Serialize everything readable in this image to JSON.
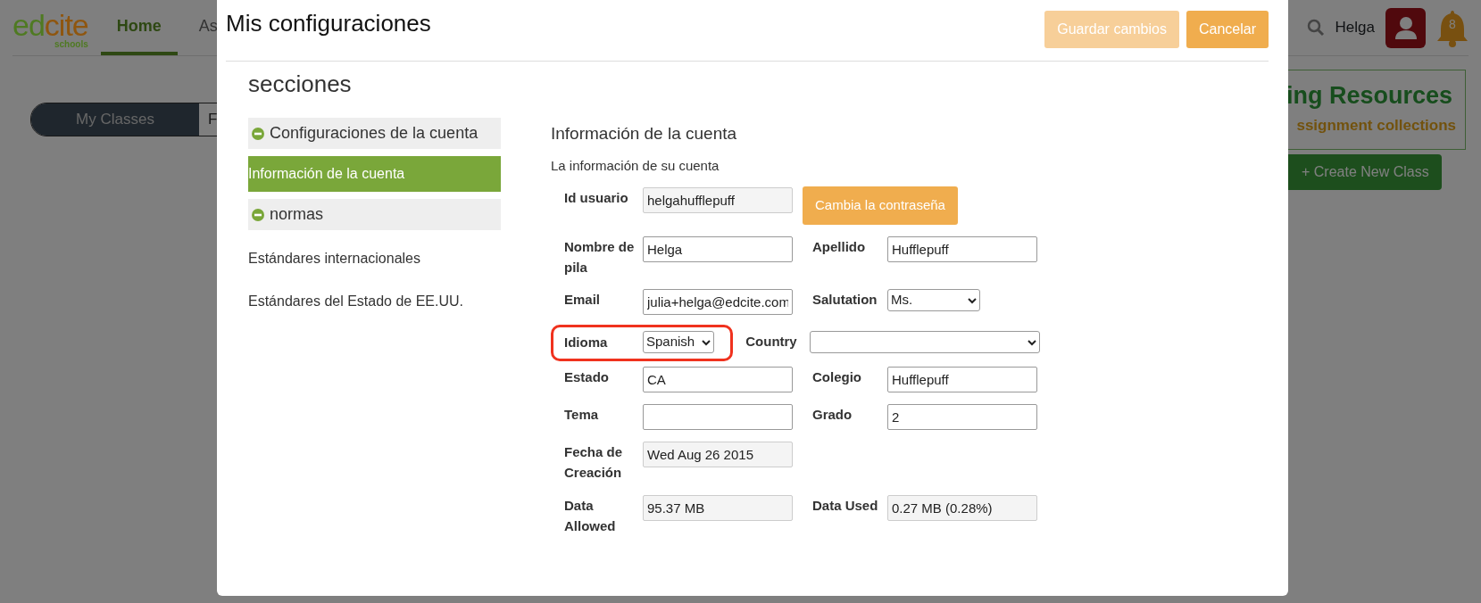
{
  "background": {
    "logo": {
      "parts": [
        {
          "text": "ed",
          "color": "#4f7a22"
        },
        {
          "text": "cite",
          "color": "#8f560f"
        }
      ],
      "tagline": "schools"
    },
    "nav": [
      {
        "label": "Home",
        "selected": true
      },
      {
        "label": "As",
        "selected": false
      }
    ],
    "class_tabs": [
      {
        "label": "My Classes",
        "selected": true
      },
      {
        "label": "F",
        "selected": false
      }
    ],
    "user": "Helga",
    "notifications": "8",
    "resources_title": "ing Resources",
    "resources_subtitle": "ssignment collections",
    "create_button": "+ Create New Class"
  },
  "modal": {
    "title": "Mis configuraciones",
    "buttons": [
      {
        "label": "Guardar cambios",
        "disabled": true
      },
      {
        "label": "Cancelar",
        "disabled": false
      }
    ],
    "sections_heading": "secciones",
    "sidebar": [
      {
        "label": "Configuraciones de la cuenta",
        "expanded": true,
        "children": [
          {
            "label": "Información de la cuenta",
            "selected": true
          }
        ]
      },
      {
        "label": "normas",
        "expanded": true,
        "children": [
          {
            "label": "Estándares internacionales",
            "selected": false
          },
          {
            "label": "Estándares del Estado de EE.UU.",
            "selected": false
          }
        ]
      }
    ],
    "content": {
      "title": "Información de la cuenta",
      "subtitle": "La información de su cuenta",
      "rows": [
        {
          "kind": "pair",
          "fields": [
            {
              "kind": "input",
              "label": "Id usuario",
              "value": "helgahufflepuff",
              "readonly": true
            },
            {
              "kind": "button",
              "label": "Cambia la contraseña"
            }
          ]
        },
        {
          "kind": "pair",
          "fields": [
            {
              "kind": "input",
              "label": "Nombre de pila",
              "value": "Helga",
              "readonly": false
            },
            {
              "kind": "input",
              "label": "Apellido",
              "value": "Hufflepuff",
              "readonly": false
            }
          ]
        },
        {
          "kind": "pair",
          "fields": [
            {
              "kind": "input",
              "label": "Email",
              "value": "julia+helga@edcite.com",
              "readonly": false
            },
            {
              "kind": "select",
              "label": "Salutation",
              "value": "Ms."
            }
          ]
        },
        {
          "kind": "compact",
          "fields": [
            {
              "kind": "select",
              "label": "Idioma",
              "value": "Spanish",
              "highlighted": true
            },
            {
              "kind": "select",
              "label": "Country",
              "highlighted": false
            }
          ]
        },
        {
          "kind": "pair",
          "fields": [
            {
              "kind": "input",
              "label": "Estado",
              "value": "CA",
              "readonly": false
            },
            {
              "kind": "input",
              "label": "Colegio",
              "value": "Hufflepuff",
              "readonly": false
            }
          ]
        },
        {
          "kind": "pair",
          "fields": [
            {
              "kind": "input",
              "label": "Tema",
              "readonly": false
            },
            {
              "kind": "input",
              "label": "Grado",
              "value": "2",
              "readonly": false
            }
          ]
        },
        {
          "kind": "pair",
          "fields": [
            {
              "kind": "input",
              "label": "Fecha de Creación",
              "value": "Wed Aug 26 2015",
              "readonly": true
            }
          ]
        },
        {
          "kind": "pair",
          "fields": [
            {
              "kind": "input",
              "label": "Data Allowed",
              "value": "95.37 MB",
              "readonly": true
            },
            {
              "kind": "input",
              "label": "Data Used",
              "value": "0.27 MB (0.28%)",
              "readonly": true
            }
          ]
        }
      ]
    }
  }
}
